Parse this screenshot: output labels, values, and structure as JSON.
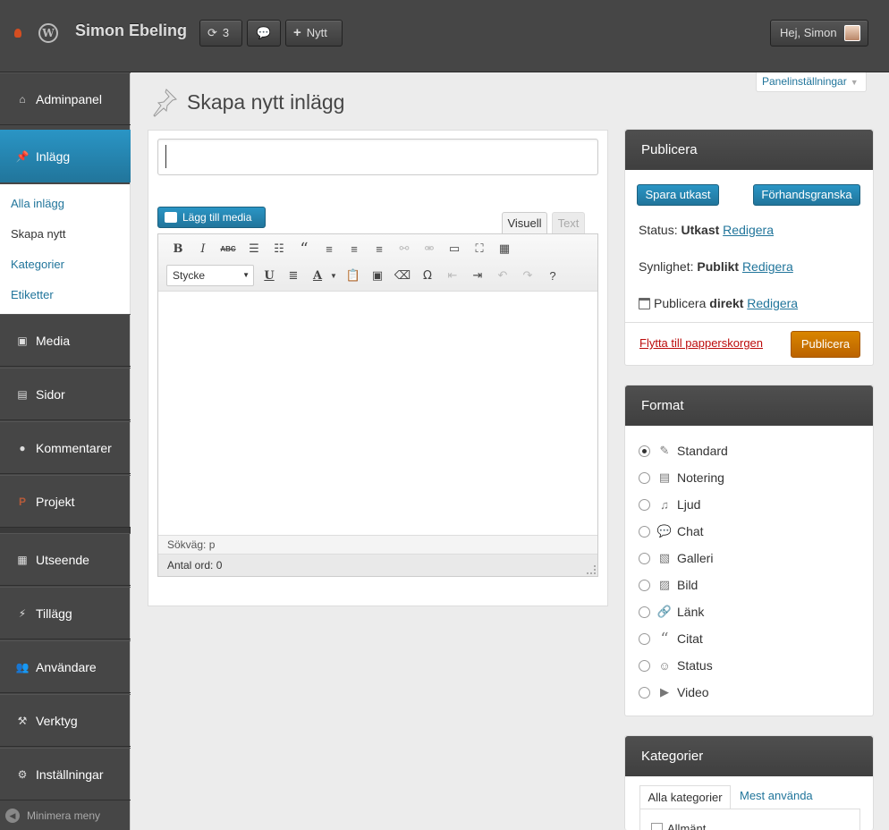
{
  "topbar": {
    "site_name": "Simon Ebeling",
    "updates_count": "3",
    "new_label": "Nytt",
    "account_label": "Hej, Simon"
  },
  "sidebar": {
    "items": [
      {
        "label": "Adminpanel",
        "icon": "home-icon"
      },
      {
        "label": "Inlägg",
        "icon": "pushpin-icon"
      },
      {
        "label": "Media",
        "icon": "media-icon"
      },
      {
        "label": "Sidor",
        "icon": "pages-icon"
      },
      {
        "label": "Kommentarer",
        "icon": "comment-icon"
      },
      {
        "label": "Projekt",
        "icon": "project-icon"
      },
      {
        "label": "Utseende",
        "icon": "appearance-icon"
      },
      {
        "label": "Tillägg",
        "icon": "plugin-icon"
      },
      {
        "label": "Användare",
        "icon": "users-icon"
      },
      {
        "label": "Verktyg",
        "icon": "tools-icon"
      },
      {
        "label": "Inställningar",
        "icon": "settings-icon"
      }
    ],
    "submenu": [
      "Alla inlägg",
      "Skapa nytt",
      "Kategorier",
      "Etiketter"
    ],
    "collapse_label": "Minimera meny"
  },
  "screen_options": "Panelinställningar",
  "page_title": "Skapa nytt inlägg",
  "editor": {
    "title_value": "",
    "add_media_label": "Lägg till media",
    "tab_visual": "Visuell",
    "tab_text": "Text",
    "format_select": "Stycke",
    "path": "Sökväg: p",
    "word_count": "Antal ord: 0"
  },
  "publish": {
    "header": "Publicera",
    "save_draft": "Spara utkast",
    "preview": "Förhandsgranska",
    "status_label": "Status:",
    "status_value": "Utkast",
    "visibility_label": "Synlighet:",
    "visibility_value": "Publikt",
    "publish_label": "Publicera",
    "publish_value": "direkt",
    "edit": "Redigera",
    "trash": "Flytta till papperskorgen",
    "publish_button": "Publicera"
  },
  "format": {
    "header": "Format",
    "selected": "Standard",
    "options": [
      {
        "label": "Standard",
        "icon": "pushpin-icon"
      },
      {
        "label": "Notering",
        "icon": "note-icon"
      },
      {
        "label": "Ljud",
        "icon": "music-icon"
      },
      {
        "label": "Chat",
        "icon": "chat-icon"
      },
      {
        "label": "Galleri",
        "icon": "gallery-icon"
      },
      {
        "label": "Bild",
        "icon": "image-icon"
      },
      {
        "label": "Länk",
        "icon": "link-icon"
      },
      {
        "label": "Citat",
        "icon": "quote-icon"
      },
      {
        "label": "Status",
        "icon": "status-icon"
      },
      {
        "label": "Video",
        "icon": "video-icon"
      }
    ]
  },
  "categories": {
    "header": "Kategorier",
    "tab_all": "Alla kategorier",
    "tab_popular": "Mest använda",
    "items": [
      "Allmänt"
    ]
  },
  "colors": {
    "accent": "#21759b",
    "admin_bar": "#464646",
    "publish_button": "#c96f00",
    "trash": "#bc0b0b"
  }
}
